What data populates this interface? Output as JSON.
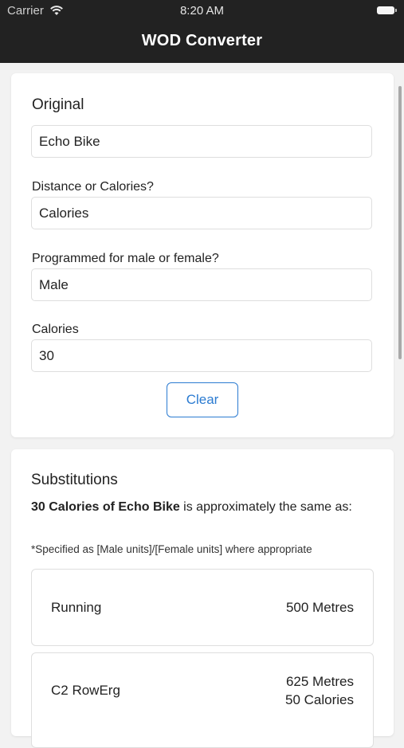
{
  "status_bar": {
    "carrier": "Carrier",
    "time": "8:20 AM"
  },
  "nav": {
    "title": "WOD Converter"
  },
  "original": {
    "heading": "Original",
    "exercise": "Echo Bike",
    "measure_label": "Distance or Calories?",
    "measure_value": "Calories",
    "gender_label": "Programmed for male or female?",
    "gender_value": "Male",
    "amount_label": "Calories",
    "amount_value": "30",
    "clear_label": "Clear"
  },
  "substitutions": {
    "heading": "Substitutions",
    "summary_bold": "30 Calories of Echo Bike",
    "summary_rest": " is approximately the same as:",
    "note": "*Specified as [Male units]/[Female units] where appropriate",
    "items": [
      {
        "name": "Running",
        "values": [
          "500 Metres"
        ]
      },
      {
        "name": "C2 RowErg",
        "values": [
          "625 Metres",
          "50 Calories"
        ]
      }
    ]
  },
  "colors": {
    "accent": "#2b7bd1",
    "nav_background": "#222222",
    "page_background": "#f2f2f2"
  }
}
